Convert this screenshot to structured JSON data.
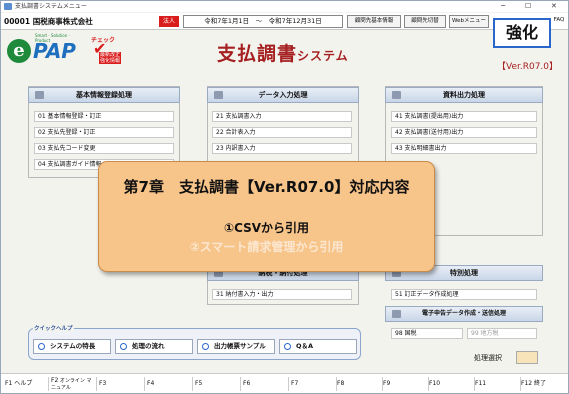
{
  "window": {
    "title": "支払調書システムメニュー"
  },
  "topbar": {
    "company": "00001 国税商事株式会社",
    "houjin": "法人",
    "period": "令和7年1月1日　～　令和7年12月31日",
    "buttons": [
      "顧問先基本情報",
      "顧問先切替",
      "Webメニュー",
      "FAQ"
    ]
  },
  "logo": {
    "pap": "PAP",
    "tagline": "Smart · Solution · Product",
    "check_label": "チェック",
    "check_sub": "最新改正 強化情報"
  },
  "app_title": "支払調書",
  "app_title_suffix": "システム",
  "badge": "強化",
  "version": "【Ver.R07.0】",
  "panels": {
    "basic": {
      "title": "基本情報登録処理",
      "items": [
        "01 基本情報登録・訂正",
        "02 支払先登録・訂正",
        "03 支払先コード変更",
        "04 支払調書ガイド情報"
      ]
    },
    "data": {
      "title": "データ入力処理",
      "items": [
        "21 支払調書入力",
        "22 合計表入力",
        "23 内訳書入力"
      ]
    },
    "output": {
      "title": "資料出力処理",
      "items": [
        "41 支払調書(提出用)出力",
        "42 支払調書(送付用)出力",
        "43 支払明細書出力"
      ]
    },
    "tax": {
      "title": "納税・納付処理",
      "items": [
        "31 納付書入力・出力"
      ]
    },
    "special": {
      "title": "特別処理",
      "items": [
        "51 訂正データ作成処理"
      ]
    },
    "etax": {
      "title": "電子申告データ作成・送信処理",
      "items": [
        "98 国税",
        "99 地方税"
      ]
    }
  },
  "overlay": {
    "title": "第7章　支払調書【Ver.R07.0】対応内容",
    "line1": "①CSVから引用",
    "line2": "②スマート請求管理から引用"
  },
  "quick_help": {
    "title": "クイックヘルプ",
    "buttons": [
      "システムの特長",
      "処理の流れ",
      "出力帳票サンプル",
      "Q＆A"
    ]
  },
  "selection": {
    "label": "処理選択",
    "value": ""
  },
  "fkeys": [
    {
      "key": "F1",
      "label": "ヘルプ"
    },
    {
      "key": "F2",
      "label": "オンライン マニュアル"
    },
    {
      "key": "F3",
      "label": ""
    },
    {
      "key": "F4",
      "label": ""
    },
    {
      "key": "F5",
      "label": ""
    },
    {
      "key": "F6",
      "label": ""
    },
    {
      "key": "F7",
      "label": ""
    },
    {
      "key": "F8",
      "label": ""
    },
    {
      "key": "F9",
      "label": ""
    },
    {
      "key": "F10",
      "label": ""
    },
    {
      "key": "F11",
      "label": ""
    },
    {
      "key": "F12",
      "label": "終了"
    }
  ]
}
